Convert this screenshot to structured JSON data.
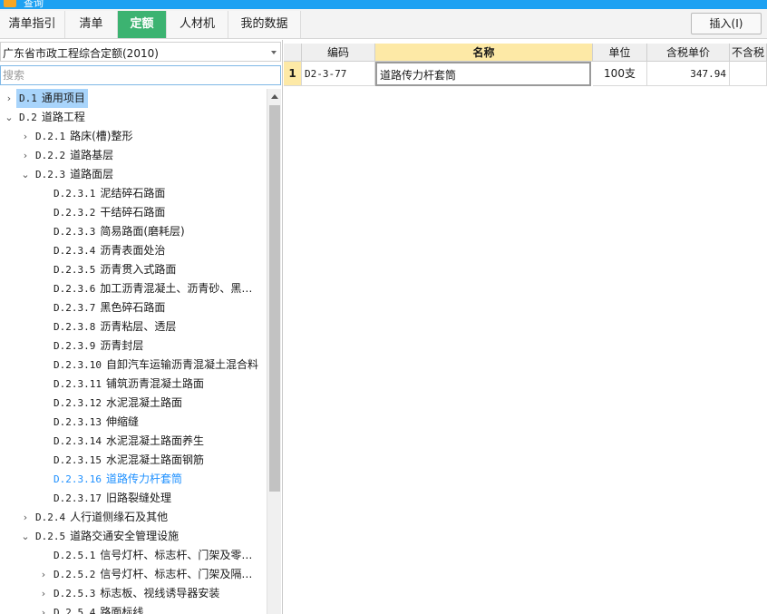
{
  "window": {
    "title": "查询"
  },
  "tabs": [
    {
      "label": "清单指引",
      "active": false
    },
    {
      "label": "清单",
      "active": false
    },
    {
      "label": "定额",
      "active": true
    },
    {
      "label": "人材机",
      "active": false
    },
    {
      "label": "我的数据",
      "active": false
    }
  ],
  "toolbar": {
    "insert_label": "插入(I)"
  },
  "left_panel": {
    "library": "广东省市政工程综合定额(2010)",
    "search_placeholder": "搜索",
    "tree": [
      {
        "code": "D.1",
        "label": "通用项目",
        "toggle": "›",
        "level": 0,
        "selected": true
      },
      {
        "code": "D.2",
        "label": "道路工程",
        "toggle": "⌄",
        "level": 0
      },
      {
        "code": "D.2.1",
        "label": "路床(槽)整形",
        "toggle": "›",
        "level": 1
      },
      {
        "code": "D.2.2",
        "label": "道路基层",
        "toggle": "›",
        "level": 1
      },
      {
        "code": "D.2.3",
        "label": "道路面层",
        "toggle": "⌄",
        "level": 1
      },
      {
        "code": "D.2.3.1",
        "label": "泥结碎石路面",
        "toggle": "",
        "level": 2
      },
      {
        "code": "D.2.3.2",
        "label": "干结碎石路面",
        "toggle": "",
        "level": 2
      },
      {
        "code": "D.2.3.3",
        "label": "简易路面(磨耗层)",
        "toggle": "",
        "level": 2
      },
      {
        "code": "D.2.3.4",
        "label": "沥青表面处治",
        "toggle": "",
        "level": 2
      },
      {
        "code": "D.2.3.5",
        "label": "沥青贯入式路面",
        "toggle": "",
        "level": 2
      },
      {
        "code": "D.2.3.6",
        "label": "加工沥青混凝土、沥青砂、黑…",
        "toggle": "",
        "level": 2
      },
      {
        "code": "D.2.3.7",
        "label": "黑色碎石路面",
        "toggle": "",
        "level": 2
      },
      {
        "code": "D.2.3.8",
        "label": "沥青粘层、透层",
        "toggle": "",
        "level": 2
      },
      {
        "code": "D.2.3.9",
        "label": "沥青封层",
        "toggle": "",
        "level": 2
      },
      {
        "code": "D.2.3.10",
        "label": "自卸汽车运输沥青混凝土混合料",
        "toggle": "",
        "level": 2
      },
      {
        "code": "D.2.3.11",
        "label": "铺筑沥青混凝土路面",
        "toggle": "",
        "level": 2
      },
      {
        "code": "D.2.3.12",
        "label": "水泥混凝土路面",
        "toggle": "",
        "level": 2
      },
      {
        "code": "D.2.3.13",
        "label": "伸缩缝",
        "toggle": "",
        "level": 2
      },
      {
        "code": "D.2.3.14",
        "label": "水泥混凝土路面养生",
        "toggle": "",
        "level": 2
      },
      {
        "code": "D.2.3.15",
        "label": "水泥混凝土路面钢筋",
        "toggle": "",
        "level": 2
      },
      {
        "code": "D.2.3.16",
        "label": "道路传力杆套筒",
        "toggle": "",
        "level": 2,
        "link": true
      },
      {
        "code": "D.2.3.17",
        "label": "旧路裂缝处理",
        "toggle": "",
        "level": 2
      },
      {
        "code": "D.2.4",
        "label": "人行道侧缘石及其他",
        "toggle": "›",
        "level": 1
      },
      {
        "code": "D.2.5",
        "label": "道路交通安全管理设施",
        "toggle": "⌄",
        "level": 1
      },
      {
        "code": "D.2.5.1",
        "label": "信号灯杆、标志杆、门架及零…",
        "toggle": "",
        "level": 2
      },
      {
        "code": "D.2.5.2",
        "label": "信号灯杆、标志杆、门架及隔…",
        "toggle": "›",
        "level": 2
      },
      {
        "code": "D.2.5.3",
        "label": "标志板、视线诱导器安装",
        "toggle": "›",
        "level": 2
      },
      {
        "code": "D.2.5.4",
        "label": "路面标线",
        "toggle": "›",
        "level": 2
      }
    ]
  },
  "grid": {
    "columns": [
      "",
      "编码",
      "名称",
      "单位",
      "含税单价",
      "不含税"
    ],
    "rows": [
      {
        "num": "1",
        "code": "D2-3-77",
        "name": "道路传力杆套筒",
        "unit": "100支",
        "price": "347.94",
        "price_ex": ""
      }
    ]
  },
  "colors": {
    "accent": "#3cb371",
    "titlebar": "#1da1f2",
    "selection": "#a8d4fb",
    "link": "#1e90ff",
    "header_highlight": "#fde9a6"
  }
}
